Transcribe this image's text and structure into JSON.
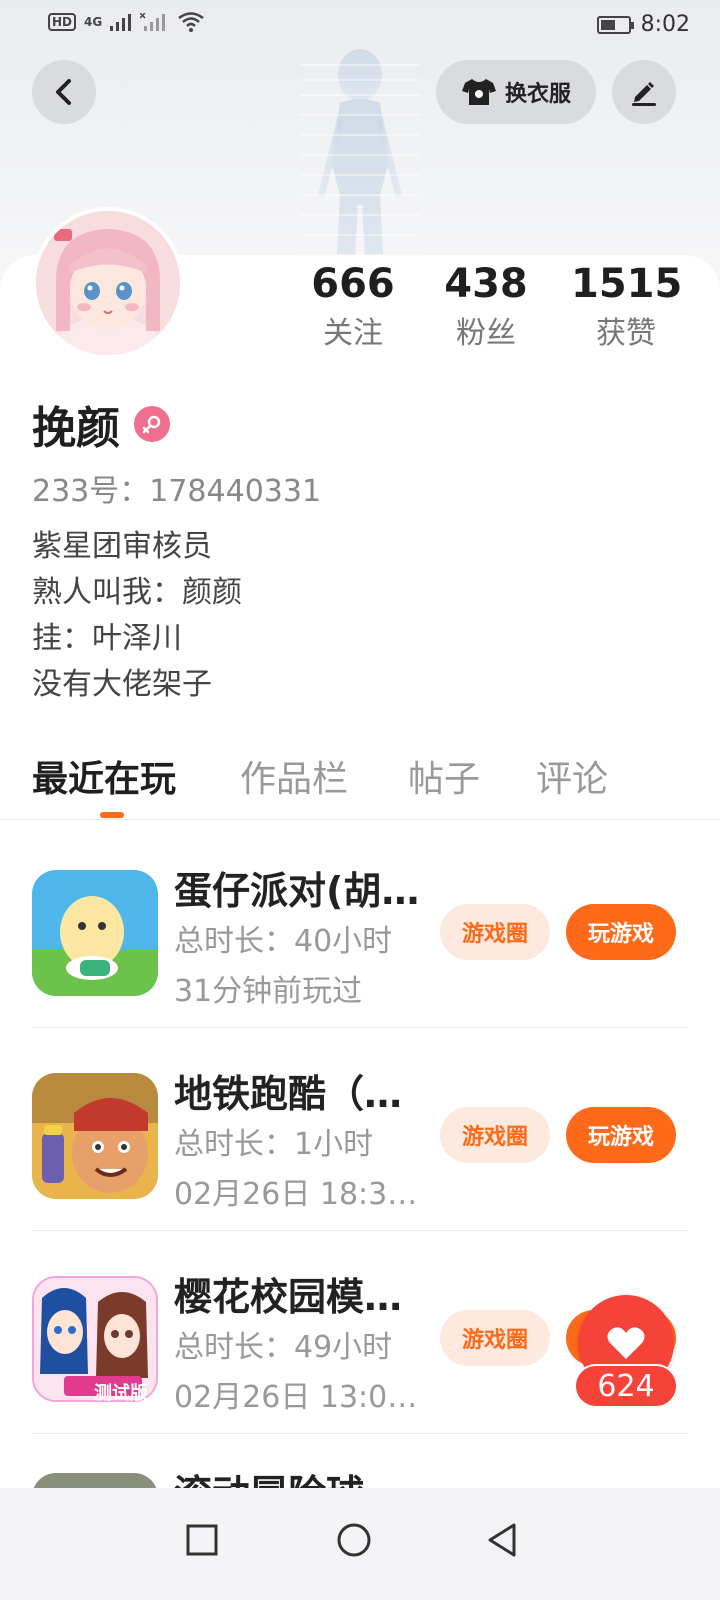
{
  "status_bar": {
    "network_hd": "HD",
    "network_4g": "4G",
    "time": "8:02"
  },
  "header": {
    "change_outfit_label": "换衣服"
  },
  "profile": {
    "stats": [
      {
        "value": "666",
        "label": "关注"
      },
      {
        "value": "438",
        "label": "粉丝"
      },
      {
        "value": "1515",
        "label": "获赞"
      }
    ],
    "username": "挽颜",
    "gender": "female",
    "uid_text": "233号：178440331",
    "bio_lines": [
      "紫星团审核员",
      "熟人叫我：颜颜",
      "挂：叶泽川",
      "没有大佬架子"
    ]
  },
  "tabs": [
    {
      "label": "最近在玩",
      "active": true
    },
    {
      "label": "作品栏",
      "active": false
    },
    {
      "label": "帖子",
      "active": false
    },
    {
      "label": "评论",
      "active": false
    }
  ],
  "games": [
    {
      "title": "蛋仔派对(胡…",
      "total_time": "总时长：40小时",
      "last_played": "31分钟前玩过",
      "circle_label": "游戏圈",
      "play_label": "玩游戏"
    },
    {
      "title": "地铁跑酷（…",
      "total_time": "总时长：1小时",
      "last_played": "02月26日 18:3…",
      "circle_label": "游戏圈",
      "play_label": "玩游戏"
    },
    {
      "title": "樱花校园模…",
      "total_time": "总时长：49小时",
      "last_played": "02月26日 13:0…",
      "circle_label": "游戏圈",
      "play_label": "玩游戏",
      "icon_badge": "测试版"
    },
    {
      "title": "滚动冒险球"
    }
  ],
  "like_float": {
    "count": "624"
  },
  "colors": {
    "accent": "#ff6a1a",
    "like_red": "#f5433a",
    "gender_pink": "#f06e90"
  }
}
